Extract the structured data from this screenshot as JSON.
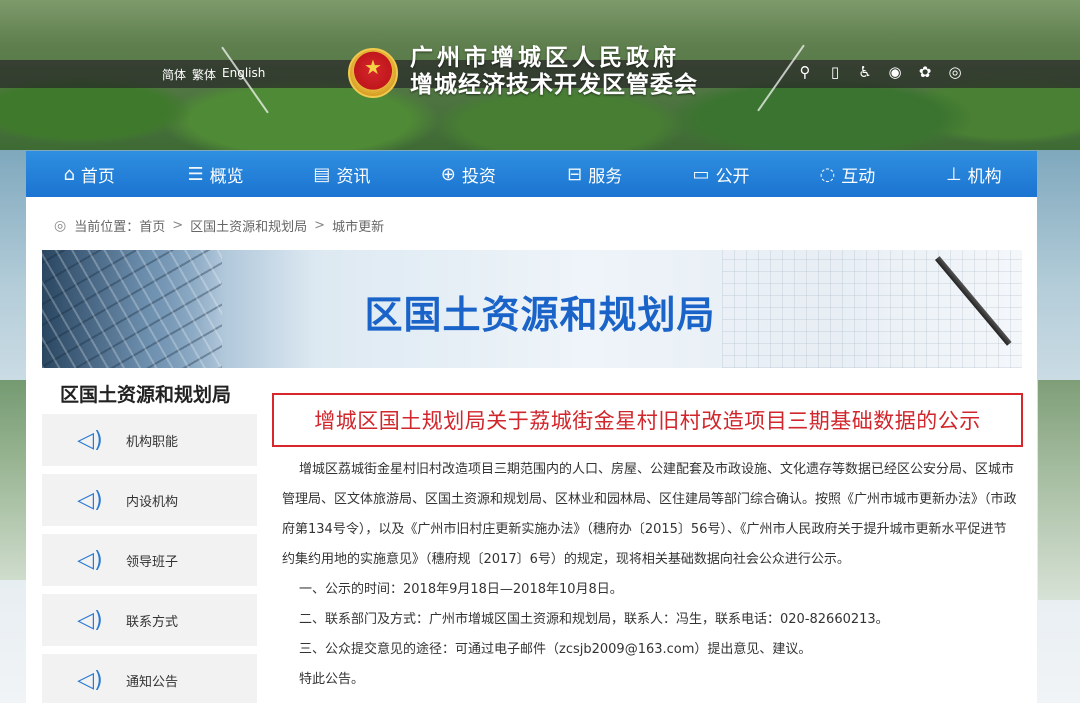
{
  "header": {
    "lang": [
      "简体",
      "繁体",
      "English"
    ],
    "title_line1": "广州市增城区人民政府",
    "title_line2": "增城经济技术开发区管委会",
    "tools": [
      {
        "name": "search-icon",
        "glyph": "🔍"
      },
      {
        "name": "mobile-icon",
        "glyph": "▯"
      },
      {
        "name": "accessibility-icon",
        "glyph": "♿"
      },
      {
        "name": "weibo-icon",
        "glyph": "◉"
      },
      {
        "name": "wechat-icon",
        "glyph": "✿"
      },
      {
        "name": "rss-icon",
        "glyph": "◎"
      }
    ]
  },
  "nav": {
    "items": [
      {
        "label": "首页",
        "icon": "home-icon"
      },
      {
        "label": "概览",
        "icon": "list-icon"
      },
      {
        "label": "资讯",
        "icon": "news-icon"
      },
      {
        "label": "投资",
        "icon": "globe-icon"
      },
      {
        "label": "服务",
        "icon": "briefcase-icon"
      },
      {
        "label": "公开",
        "icon": "monitor-icon"
      },
      {
        "label": "互动",
        "icon": "chat-icon"
      },
      {
        "label": "机构",
        "icon": "org-icon"
      }
    ]
  },
  "breadcrumb": {
    "prefix": "当前位置：首页",
    "items": [
      "区国土资源和规划局",
      "城市更新"
    ]
  },
  "banner": {
    "title": "区国土资源和规划局"
  },
  "sidebar": {
    "title": "区国土资源和规划局",
    "items": [
      {
        "label": "机构职能"
      },
      {
        "label": "内设机构"
      },
      {
        "label": "领导班子"
      },
      {
        "label": "联系方式"
      },
      {
        "label": "通知公告"
      }
    ]
  },
  "article": {
    "title": "增城区国土规划局关于荔城街金星村旧村改造项目三期基础数据的公示",
    "para1": "增城区荔城街金星村旧村改造项目三期范围内的人口、房屋、公建配套及市政设施、文化遗存等数据已经区公安分局、区城市管理局、区文体旅游局、区国土资源和规划局、区林业和园林局、区住建局等部门综合确认。按照《广州市城市更新办法》（市政府第134号令），以及《广州市旧村庄更新实施办法》（穗府办〔2015〕56号）、《广州市人民政府关于提升城市更新水平促进节约集约用地的实施意见》（穗府规〔2017〕6号）的规定，现将相关基础数据向社会公众进行公示。",
    "item1": "一、公示的时间：2018年9月18日—2018年10月8日。",
    "item2": "二、联系部门及方式：广州市增城区国土资源和规划局，联系人：冯生，联系电话：020-82660213。",
    "item3": "三、公众提交意见的途径：可通过电子邮件（zcsjb2009@163.com）提出意见、建议。",
    "closing": "特此公告。"
  }
}
